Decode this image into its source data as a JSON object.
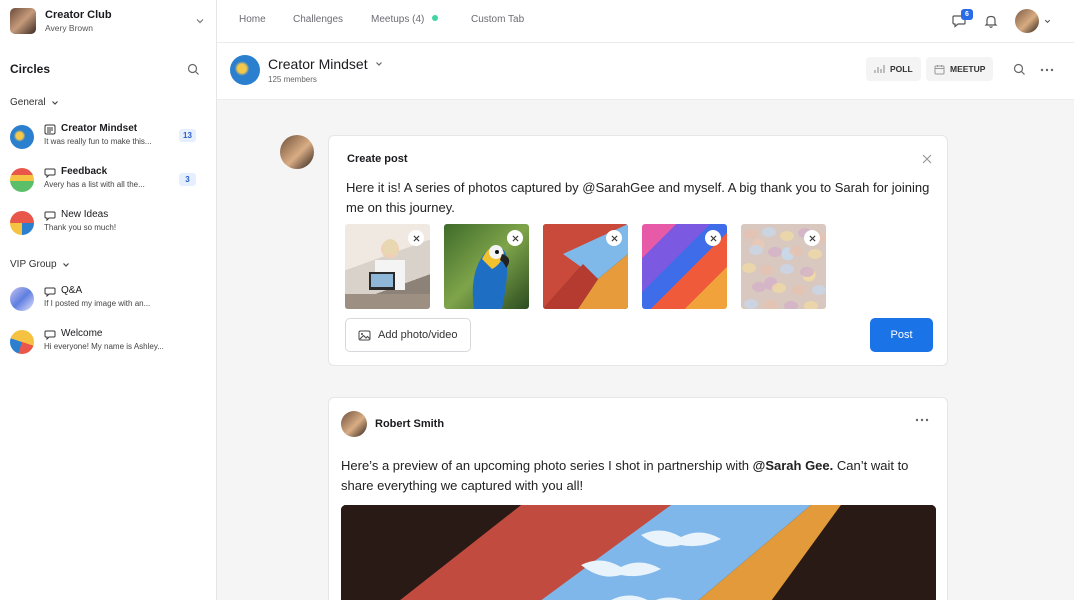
{
  "club": {
    "name": "Creator Club",
    "user": "Avery Brown"
  },
  "sidebar": {
    "title": "Circles",
    "groups": [
      {
        "label": "General"
      },
      {
        "label": "VIP Group"
      }
    ],
    "items": [
      {
        "title": "Creator Mindset",
        "preview": "It was really fun to make this...",
        "badge": "13"
      },
      {
        "title": "Feedback",
        "preview": "Avery has a list with all the...",
        "badge": "3"
      },
      {
        "title": "New Ideas",
        "preview": "Thank you so much!"
      },
      {
        "title": "Q&A",
        "preview": "If I posted my image with an..."
      },
      {
        "title": "Welcome",
        "preview": "Hi everyone! My name is Ashley..."
      }
    ]
  },
  "nav": {
    "tabs": [
      "Home",
      "Challenges",
      "Meetups (4)",
      "Custom Tab"
    ],
    "message_badge": "6"
  },
  "circle": {
    "name": "Creator Mindset",
    "members": "125 members",
    "poll_label": "POLL",
    "meetup_label": "MEETUP"
  },
  "composer": {
    "title": "Create post",
    "text": "Here it is! A series of photos captured by @SarahGee and myself. A big thank you to Sarah for joining me on this journey.",
    "add_media_label": "Add photo/video",
    "post_label": "Post"
  },
  "post": {
    "author": "Robert Smith",
    "text_before": "Here’s a preview of an upcoming photo series I shot in partnership with ",
    "mention": "@Sarah Gee.",
    "text_after": " Can’t wait to share everything we captured with you all!"
  },
  "colors": {
    "accent": "#1b73e8",
    "badge_bg": "#e6effd",
    "online_dot": "#3fd4a0"
  }
}
